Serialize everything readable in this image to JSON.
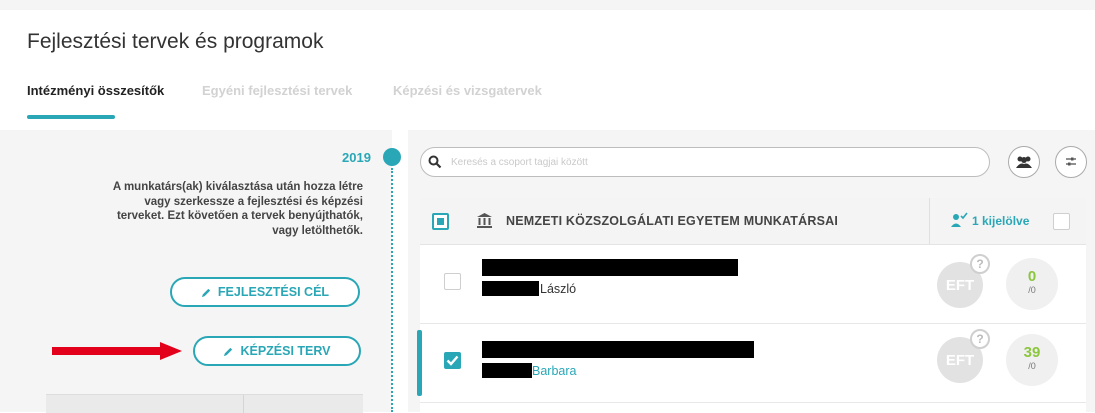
{
  "page": {
    "title": "Fejlesztési tervek és programok"
  },
  "tabs": [
    {
      "label": "Intézményi összesítők",
      "active": true
    },
    {
      "label": "Egyéni fejlesztési tervek",
      "active": false
    },
    {
      "label": "Képzési és vizsgatervek",
      "active": false
    }
  ],
  "left": {
    "year": "2019",
    "info_text": "A munkatárs(ak) kiválasztása után hozza létre vagy szerkessze a fejlesztési és képzési terveket. Ezt követően a tervek benyújthatók, vagy letölthetők.",
    "buttons": {
      "fejlesztesi_cel": "FEJLESZTÉSI CÉL",
      "kepzesi_terv": "KÉPZÉSI TERV"
    }
  },
  "search": {
    "placeholder": "Keresés a csoport tagjai között"
  },
  "list": {
    "org_name": "NEMZETI KÖZSZOLGÁLATI EGYETEM MUNKATÁRSAI",
    "selected_count": "1 kijelölve",
    "rows": [
      {
        "first_name": "László",
        "checked": false,
        "badge": "EFT",
        "badge_help": "?",
        "count": "0",
        "total": "/0"
      },
      {
        "first_name": "Barbara",
        "checked": true,
        "badge": "EFT",
        "badge_help": "?",
        "count": "39",
        "total": "/0"
      }
    ]
  },
  "colors": {
    "accent": "#2aa7b6",
    "count_green": "#8cc63f",
    "arrow_red": "#e3001b"
  },
  "icons": [
    "search-icon",
    "group-icon",
    "filter-settings-icon",
    "institution-icon",
    "user-check-icon",
    "pencil-icon",
    "checkmark-icon"
  ]
}
